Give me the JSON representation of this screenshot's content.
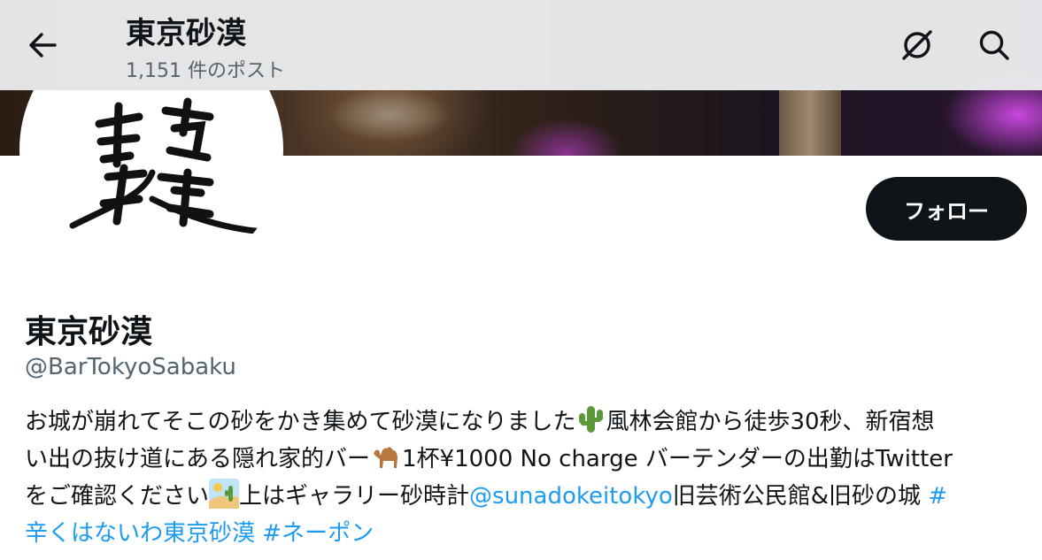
{
  "header": {
    "title": "東京砂漠",
    "post_count": "1,151 件のポスト"
  },
  "profile": {
    "display_name": "東京砂漠",
    "handle": "@BarTokyoSabaku",
    "follow_label": "フォロー",
    "avatar_logo_text": "東京砂漠"
  },
  "bio": {
    "line1_a": "お城が崩れてそこの砂をかき集めて砂漠になりました",
    "line1_b": "風林会館から徒歩30秒、新宿想",
    "line2_a": "い出の抜け道にある隠れ家的バー",
    "line2_b": "1杯¥1000 No charge バーテンダーの出勤はTwitter",
    "line3_a": "をご確認ください",
    "line3_b": "上はギャラリー砂時計",
    "mention": "@sunadokeitokyo",
    "line3_c": "旧芸術公民館&旧砂の城 ",
    "hashtag1_part1": "#",
    "hashtag1_part2": "辛くはないわ東京砂漠",
    "hashtag2": "#ネーポン",
    "emoji_names": [
      "cactus-emoji",
      "camel-emoji",
      "desert-emoji"
    ]
  },
  "icons": [
    "back-arrow-icon",
    "grok-icon",
    "search-icon"
  ],
  "colors": {
    "text_primary": "#0f1419",
    "text_secondary": "#536471",
    "link": "#1d9bf0",
    "follow_button_bg": "#0f1419"
  }
}
